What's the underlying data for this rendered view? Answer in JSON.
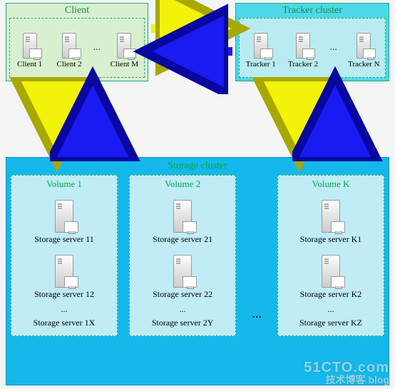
{
  "client": {
    "title": "Client",
    "nodes": [
      "Client 1",
      "Client 2",
      "Client M"
    ]
  },
  "tracker": {
    "title": "Tracker cluster",
    "nodes": [
      "Tracker 1",
      "Tracker 2",
      "Tracker N"
    ]
  },
  "storage": {
    "title": "Storage cluster",
    "volumes": [
      {
        "title": "Volume 1",
        "servers": [
          "Storage server 11",
          "Storage server 12"
        ],
        "etc": "...",
        "last": "Storage server 1X"
      },
      {
        "title": "Volume 2",
        "servers": [
          "Storage server 21",
          "Storage server 22"
        ],
        "etc": "...",
        "last": "Storage server 2Y"
      },
      {
        "title": "Volume K",
        "servers": [
          "Storage server K1",
          "Storage server K2"
        ],
        "etc": "...",
        "last": "Storage server KZ"
      }
    ]
  },
  "arrows": {
    "client_tracker_req": "yellow",
    "client_tracker_resp": "blue",
    "client_storage_req": "yellow",
    "client_storage_resp": "blue",
    "tracker_storage_req": "yellow",
    "tracker_storage_resp": "blue"
  },
  "colors": {
    "yellow": "#f2f20a",
    "blue": "#1a1af2",
    "clientBg": "#d8f0d0",
    "trackerBg": "#4dd8e8",
    "storageBg": "#15b8ea"
  },
  "watermark": {
    "line1": "51CTO.com",
    "line2": "技术博客 blog"
  },
  "ellipsis": "..."
}
